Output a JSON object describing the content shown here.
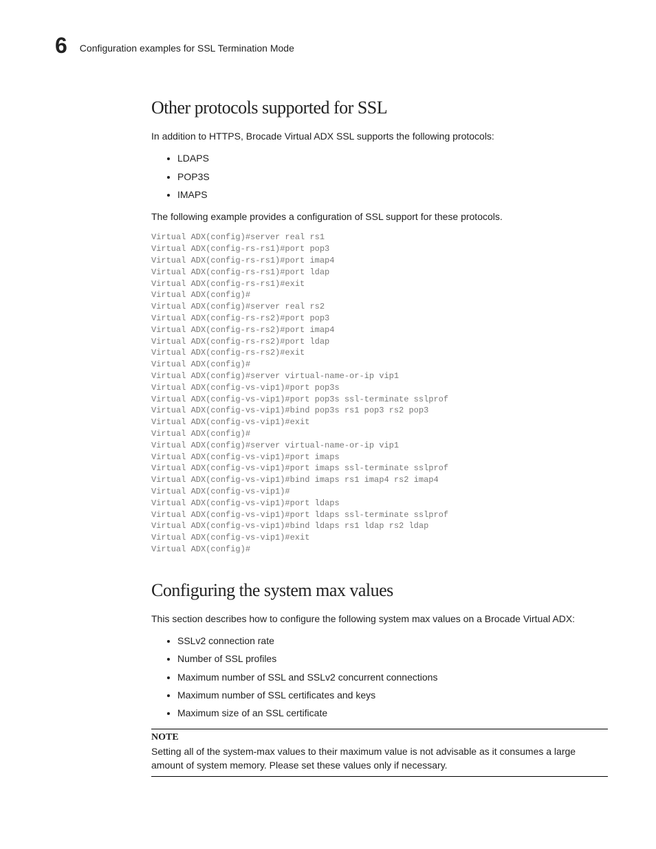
{
  "header": {
    "chapter_number": "6",
    "section_title": "Configuration examples for SSL Termination Mode"
  },
  "section1": {
    "heading": "Other protocols supported for SSL",
    "intro": "In addition to HTTPS, Brocade Virtual ADX SSL supports the following protocols:",
    "bullets": [
      "LDAPS",
      "POP3S",
      "IMAPS"
    ],
    "post_bullets": "The following example provides a configuration of SSL support for these protocols.",
    "code": "Virtual ADX(config)#server real rs1\nVirtual ADX(config-rs-rs1)#port pop3\nVirtual ADX(config-rs-rs1)#port imap4\nVirtual ADX(config-rs-rs1)#port ldap\nVirtual ADX(config-rs-rs1)#exit\nVirtual ADX(config)#\nVirtual ADX(config)#server real rs2\nVirtual ADX(config-rs-rs2)#port pop3\nVirtual ADX(config-rs-rs2)#port imap4\nVirtual ADX(config-rs-rs2)#port ldap\nVirtual ADX(config-rs-rs2)#exit\nVirtual ADX(config)#\nVirtual ADX(config)#server virtual-name-or-ip vip1\nVirtual ADX(config-vs-vip1)#port pop3s\nVirtual ADX(config-vs-vip1)#port pop3s ssl-terminate sslprof\nVirtual ADX(config-vs-vip1)#bind pop3s rs1 pop3 rs2 pop3\nVirtual ADX(config-vs-vip1)#exit\nVirtual ADX(config)#\nVirtual ADX(config)#server virtual-name-or-ip vip1\nVirtual ADX(config-vs-vip1)#port imaps\nVirtual ADX(config-vs-vip1)#port imaps ssl-terminate sslprof\nVirtual ADX(config-vs-vip1)#bind imaps rs1 imap4 rs2 imap4\nVirtual ADX(config-vs-vip1)#\nVirtual ADX(config-vs-vip1)#port ldaps\nVirtual ADX(config-vs-vip1)#port ldaps ssl-terminate sslprof\nVirtual ADX(config-vs-vip1)#bind ldaps rs1 ldap rs2 ldap\nVirtual ADX(config-vs-vip1)#exit\nVirtual ADX(config)#"
  },
  "section2": {
    "heading": "Configuring the system max values",
    "intro": "This section describes how to configure the following system max values on a Brocade Virtual ADX:",
    "bullets": [
      "SSLv2 connection rate",
      "Number of SSL profiles",
      "Maximum number of SSL and SSLv2 concurrent connections",
      "Maximum number of SSL certificates and keys",
      "Maximum size of an SSL certificate"
    ],
    "note_label": "NOTE",
    "note_text": "Setting all of the system-max values to their maximum value is not advisable as it consumes a large amount of system memory. Please set these values only if necessary."
  }
}
